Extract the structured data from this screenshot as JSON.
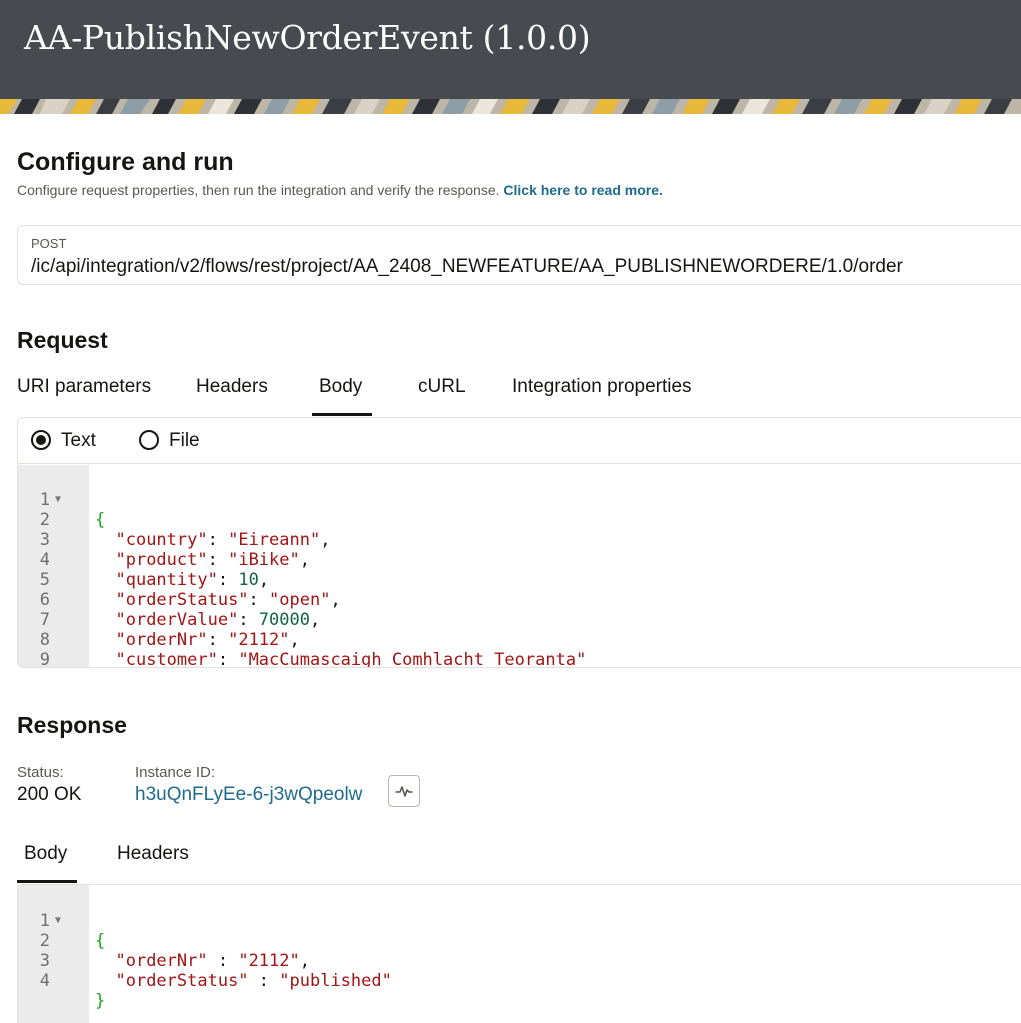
{
  "header": {
    "title": "AA-PublishNewOrderEvent (1.0.0)"
  },
  "configure": {
    "title": "Configure and run",
    "subtitle": "Configure request properties, then run the integration and verify the response.",
    "read_more": "Click here to read more.",
    "method": "POST",
    "url": "/ic/api/integration/v2/flows/rest/project/AA_2408_NEWFEATURE/AA_PUBLISHNEWORDERE/1.0/order"
  },
  "request": {
    "title": "Request",
    "tabs": [
      "URI parameters",
      "Headers",
      "Body",
      "cURL",
      "Integration properties"
    ],
    "active_tab": "Body",
    "mode_options": {
      "text": "Text",
      "file": "File"
    },
    "selected_mode": "Text",
    "body_lines": [
      "{",
      "\"country\": \"Eireann\",",
      "\"product\": \"iBike\",",
      "\"quantity\": 10,",
      "\"orderStatus\": \"open\",",
      "\"orderValue\": 70000,",
      "\"orderNr\": \"2112\",",
      "\"customer\": \"MacCumascaigh Comhlacht Teoranta\"",
      "}"
    ]
  },
  "response": {
    "title": "Response",
    "status_label": "Status:",
    "status_value": "200 OK",
    "instance_label": "Instance ID:",
    "instance_value": "h3uQnFLyEe-6-j3wQpeolw",
    "activity_icon": "activity-pulse-icon",
    "tabs": [
      "Body",
      "Headers"
    ],
    "active_tab": "Body",
    "body_lines": [
      "{",
      "\"orderNr\" : \"2112\",",
      "\"orderStatus\" : \"published\"",
      "}"
    ]
  },
  "colors": {
    "header_bg": "#474b50",
    "link": "#1f6b8f",
    "brace": "#1aa51a",
    "string": "#a31515",
    "number": "#116644"
  }
}
